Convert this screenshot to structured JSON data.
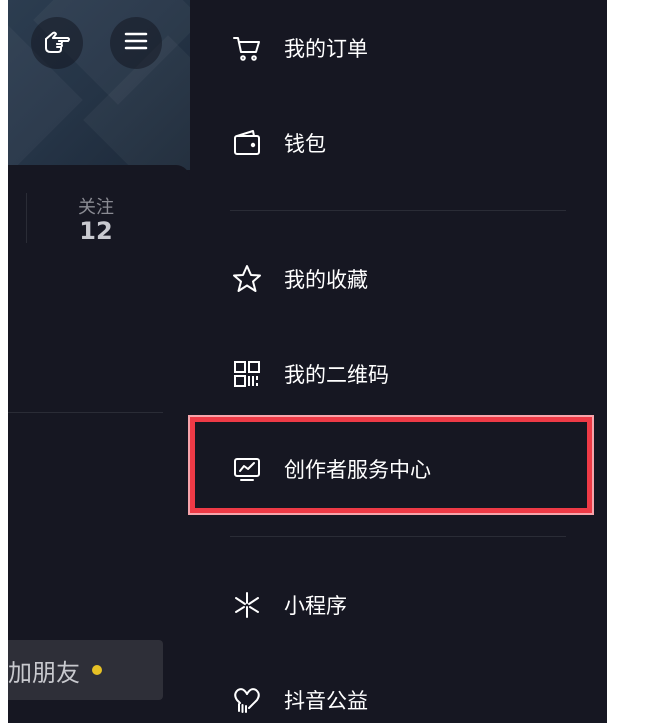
{
  "profile": {
    "stats": {
      "following_label": "关注",
      "following_count": "12"
    },
    "add_friend_label": "加朋友"
  },
  "menu": {
    "items": [
      {
        "id": "orders",
        "label": "我的订单",
        "icon": "cart-icon"
      },
      {
        "id": "wallet",
        "label": "钱包",
        "icon": "wallet-icon"
      },
      {
        "id": "favorites",
        "label": "我的收藏",
        "icon": "star-icon"
      },
      {
        "id": "qrcode",
        "label": "我的二维码",
        "icon": "qr-code-icon"
      },
      {
        "id": "creator",
        "label": "创作者服务中心",
        "icon": "analytics-monitor-icon"
      },
      {
        "id": "miniapps",
        "label": "小程序",
        "icon": "mini-program-icon"
      },
      {
        "id": "charity",
        "label": "抖音公益",
        "icon": "heart-hands-icon"
      }
    ]
  },
  "colors": {
    "panel_bg": "#161722",
    "highlight_border": "#ee3a46",
    "notification_dot": "#e6c125"
  }
}
